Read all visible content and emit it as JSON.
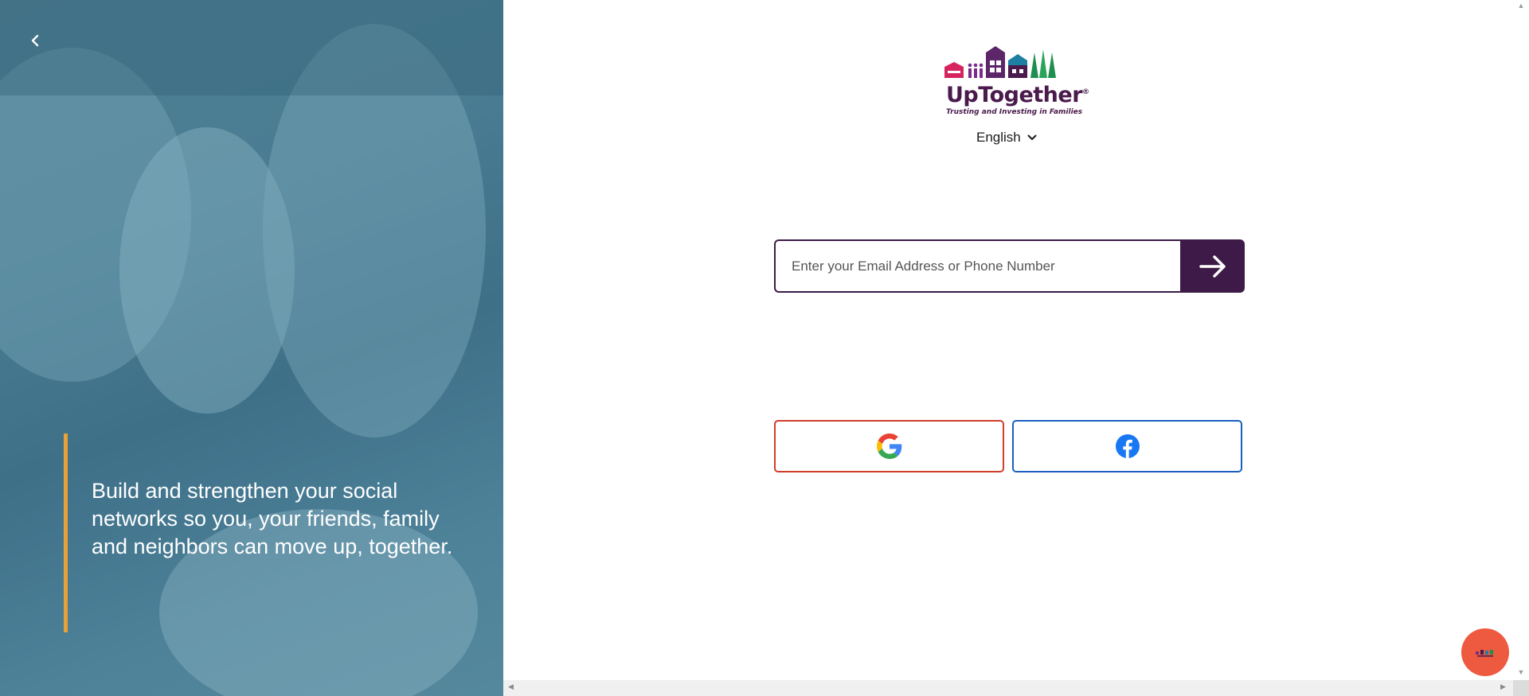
{
  "hero": {
    "back_icon": "chevron-left-icon",
    "quote": "Build and strengthen your social networks so you, your friends, family and neighbors can move up, together.",
    "accent_color": "#e8a13a"
  },
  "brand": {
    "name": "UpTogether",
    "registered": "®",
    "tagline": "Trusting and Investing in Families",
    "color": "#4a1a4c"
  },
  "language": {
    "selected": "English",
    "icon": "chevron-down-icon"
  },
  "login": {
    "placeholder": "Enter your Email Address or Phone Number",
    "value": "",
    "submit_icon": "arrow-right-icon",
    "button_color": "#3d1a47"
  },
  "social": {
    "google_icon": "google-icon",
    "google_border": "#d23c2a",
    "facebook_icon": "facebook-icon",
    "facebook_border": "#1b5fc0"
  },
  "chat": {
    "icon": "chat-launcher-icon",
    "color": "#ee5a3f"
  }
}
